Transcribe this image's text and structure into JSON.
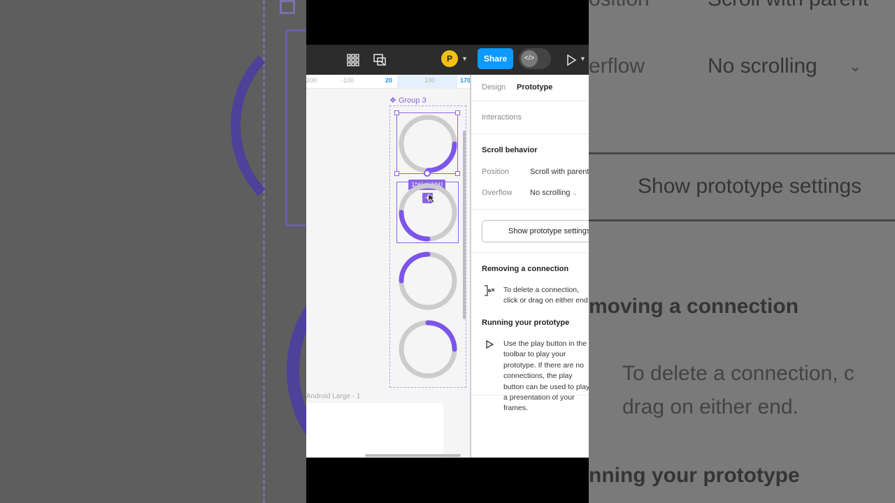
{
  "toolbar": {
    "avatar_initial": "P",
    "share_label": "Share",
    "icons": [
      "grid-icon",
      "prototype-frame-icon",
      "chevron-down-icon",
      "code-icon",
      "play-icon",
      "chevron-down-icon"
    ]
  },
  "ruler": {
    "ticks": [
      "200",
      "-100",
      "20",
      "100",
      "170"
    ]
  },
  "canvas": {
    "group_label": "Group 3",
    "size_badge": "150 × 150",
    "frame_label": "Android Large - 1"
  },
  "panel": {
    "tabs": [
      {
        "label": "Design",
        "active": false
      },
      {
        "label": "Prototype",
        "active": true
      }
    ],
    "interactions_label": "Interactions",
    "scroll_behavior": {
      "title": "Scroll behavior",
      "position_label": "Position",
      "position_value": "Scroll with parent",
      "overflow_label": "Overflow",
      "overflow_value": "No scrolling"
    },
    "show_settings_button": "Show prototype settings",
    "removing": {
      "title": "Removing a connection",
      "text": "To delete a connection, click or drag on either end."
    },
    "running": {
      "title": "Running your prototype",
      "text": "Use the play button in the toolbar to play your prototype. If there are no connections, the play button can be used to play a presentation of your frames."
    }
  },
  "background_zoom": {
    "position_fragment": "osition",
    "position_value": "Scroll with parent",
    "overflow_fragment": "erflow",
    "overflow_value": "No scrolling",
    "button": "Show prototype settings",
    "removing_title": "moving a connection",
    "removing_line1": "To delete a connection, c",
    "removing_line2": "drag on either end.",
    "running_title": "nning your prototype"
  },
  "colors": {
    "accent": "#8a63e6",
    "share": "#0d99ff",
    "avatar": "#f2c012",
    "toolbar": "#2c2c2c"
  }
}
